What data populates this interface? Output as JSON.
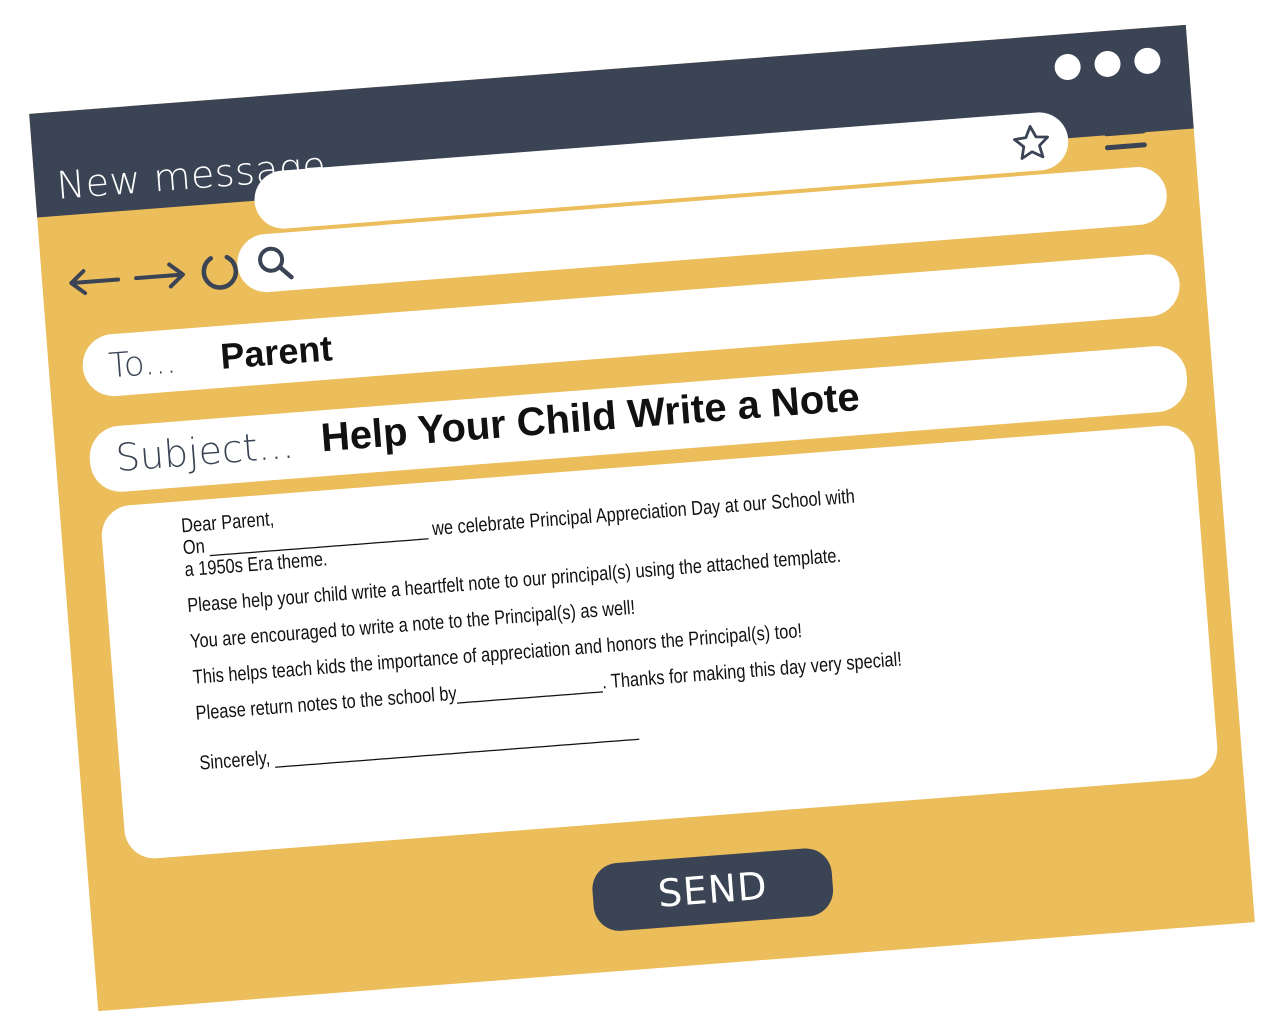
{
  "window": {
    "title": "New message"
  },
  "colors": {
    "accent": "#ecbd5b",
    "dark": "#3b4455",
    "white": "#ffffff"
  },
  "icons": {
    "window_dots": "more-dots-icon",
    "star": "star-icon",
    "menu": "hamburger-menu-icon",
    "back": "arrow-left-icon",
    "forward": "arrow-right-icon",
    "reload": "reload-icon",
    "search": "search-icon"
  },
  "compose": {
    "to_label": "To...",
    "to_value": "Parent",
    "subject_label": "Subject...",
    "subject_value": "Help Your Child Write a Note"
  },
  "letter": {
    "line1": "Dear Parent,",
    "line2": "On ________________________ we celebrate Principal Appreciation Day at our School with",
    "line3": "a 1950s Era theme.",
    "line4": "Please help your child write a heartfelt note to our principal(s) using the attached template.",
    "line5": "You are encouraged to write a note to the Principal(s) as well!",
    "line6": "This helps teach kids the importance of appreciation and honors the Principal(s) too!",
    "line7": "Please return notes to the school by________________. Thanks for making this day very special!",
    "line8": "Sincerely, ________________________________________"
  },
  "actions": {
    "send_label": "SEND"
  }
}
